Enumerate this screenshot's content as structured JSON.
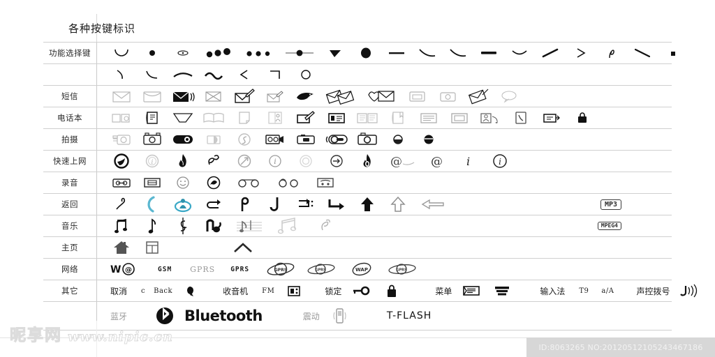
{
  "page": {
    "title": "各种按键标识"
  },
  "rows": [
    {
      "label": "功能选择键",
      "cells": [
        {
          "icon": "arc-down-icon"
        },
        {
          "icon": "dot-icon"
        },
        {
          "icon": "small-oval-icon"
        },
        {
          "icon": "three-dots-bold-icon"
        },
        {
          "icon": "three-dots-icon"
        },
        {
          "icon": "dot-with-line-icon"
        },
        {
          "icon": "triangle-down-icon"
        },
        {
          "icon": "big-dot-icon"
        },
        {
          "icon": "dash-icon"
        },
        {
          "icon": "curve-down-right-icon"
        },
        {
          "icon": "curve-down-right-icon"
        },
        {
          "icon": "dash-bold-icon"
        },
        {
          "icon": "arc-shallow-icon"
        },
        {
          "icon": "slash-up-icon"
        },
        {
          "icon": "chevron-right-icon"
        },
        {
          "icon": "loop-stroke-icon"
        },
        {
          "icon": "slash-down-icon"
        },
        {
          "icon": "square-dot-icon"
        }
      ]
    },
    {
      "label": "",
      "cells": [
        {
          "icon": "hook-stroke-icon"
        },
        {
          "icon": "curve-stroke-icon"
        },
        {
          "icon": "swoosh-icon"
        },
        {
          "icon": "tilde-icon"
        },
        {
          "icon": "chevron-left-icon"
        },
        {
          "icon": "corner-bracket-icon"
        },
        {
          "icon": "circle-outline-icon"
        }
      ]
    },
    {
      "label": "短信",
      "cells": [
        {
          "icon": "envelope-outline-icon"
        },
        {
          "icon": "envelope-flap-icon"
        },
        {
          "icon": "envelope-sound-icon"
        },
        {
          "icon": "envelope-cross-icon"
        },
        {
          "icon": "envelope-pen-icon"
        },
        {
          "icon": "envelope-small-pen-icon"
        },
        {
          "icon": "envelope-bird-icon"
        },
        {
          "icon": "envelope-pair-icon"
        },
        {
          "icon": "envelope-heart-icon"
        },
        {
          "icon": "envelope-box-icon"
        },
        {
          "icon": "envelope-camera-icon"
        },
        {
          "icon": "envelope-arrow-icon"
        },
        {
          "icon": "speech-bubble-icon"
        }
      ]
    },
    {
      "label": "电话本",
      "cells": [
        {
          "icon": "book-search-icon"
        },
        {
          "icon": "contact-card-icon"
        },
        {
          "icon": "open-fold-icon"
        },
        {
          "icon": "open-book-icon"
        },
        {
          "icon": "page-icon"
        },
        {
          "icon": "book-person-icon"
        },
        {
          "icon": "card-pen-icon"
        },
        {
          "icon": "id-card-icon"
        },
        {
          "icon": "open-book-lines-icon"
        },
        {
          "icon": "book-tab-icon"
        },
        {
          "icon": "list-lines-icon"
        },
        {
          "icon": "card-box-icon"
        },
        {
          "icon": "contacts-people-icon"
        },
        {
          "icon": "phone-card-icon"
        },
        {
          "icon": "card-arrow-icon"
        },
        {
          "icon": "lock-book-icon"
        }
      ]
    },
    {
      "label": "拍摄",
      "cells": [
        {
          "icon": "camera-outline-icon"
        },
        {
          "icon": "camera-body-icon"
        },
        {
          "icon": "camera-solid-icon"
        },
        {
          "icon": "camera-flash-icon"
        },
        {
          "icon": "shutter-circle-icon"
        },
        {
          "icon": "video-camera-icon"
        },
        {
          "icon": "compact-camera-icon"
        },
        {
          "icon": "camera-lens-ring-icon"
        },
        {
          "icon": "photo-camera-icon"
        },
        {
          "icon": "lens-small-icon"
        },
        {
          "icon": "lens-solid-icon"
        }
      ]
    },
    {
      "label": "快速上网",
      "cells": [
        {
          "icon": "e-circle-solid-icon"
        },
        {
          "icon": "i-circle-gray-icon"
        },
        {
          "icon": "flame-icon"
        },
        {
          "icon": "e-script-icon"
        },
        {
          "icon": "target-arrow-icon"
        },
        {
          "icon": "i-circle-icon"
        },
        {
          "icon": "circle-ring-icon"
        },
        {
          "icon": "arrow-circle-icon"
        },
        {
          "icon": "flame-bold-icon"
        },
        {
          "icon": "at-tail-icon"
        },
        {
          "icon": "at-icon"
        },
        {
          "icon": "i-italic-icon"
        },
        {
          "icon": "info-circle-icon"
        }
      ]
    },
    {
      "label": "录音",
      "cells": [
        {
          "icon": "cassette-icon"
        },
        {
          "icon": "tape-icon"
        },
        {
          "icon": "smiley-icon"
        },
        {
          "icon": "record-circle-icon"
        },
        {
          "icon": "reel-pair-icon"
        },
        {
          "icon": "reel-small-icon"
        },
        {
          "icon": "tape-box-icon"
        }
      ]
    },
    {
      "label": "返回",
      "badge": "MP3",
      "cells": [
        {
          "icon": "swirl-arrow-icon"
        },
        {
          "icon": "crescent-arrow-icon"
        },
        {
          "icon": "target-person-icon"
        },
        {
          "icon": "return-arrow-icon"
        },
        {
          "icon": "hook-arrow-icon"
        },
        {
          "icon": "down-hook-icon"
        },
        {
          "icon": "tab-arrow-icon"
        },
        {
          "icon": "enter-arrow-icon"
        },
        {
          "icon": "up-arrow-solid-icon"
        },
        {
          "icon": "up-arrow-outline-icon"
        },
        {
          "icon": "left-arrow-outline-icon"
        }
      ]
    },
    {
      "label": "音乐",
      "badge": "MPEG4",
      "badge_sub": "4",
      "cells": [
        {
          "icon": "beamed-notes-icon"
        },
        {
          "icon": "eighth-note-icon"
        },
        {
          "icon": "clef-icon"
        },
        {
          "icon": "note-bold-icon"
        },
        {
          "icon": "staff-notes-icon"
        },
        {
          "icon": "double-note-gray-icon"
        },
        {
          "icon": "note-sketch-icon"
        }
      ]
    },
    {
      "label": "主页",
      "cells": [
        {
          "icon": "home-solid-icon"
        },
        {
          "icon": "window-grid-icon"
        },
        {
          "icon": "roof-icon"
        }
      ]
    },
    {
      "label": "网络",
      "cells": [
        {
          "text": "W@P",
          "style": "wap"
        },
        {
          "text": "GSM",
          "style": "mono"
        },
        {
          "text": "GPRS",
          "style": "serif-gray"
        },
        {
          "text": "GPRS",
          "style": "mono"
        },
        {
          "icon": "orbit-gprs-icon"
        },
        {
          "icon": "orbit-gprs-small-icon"
        },
        {
          "icon": "orbit-wap-icon"
        },
        {
          "icon": "orbit-gprs-alt-icon"
        }
      ]
    },
    {
      "label": "其它",
      "cells": [
        {
          "text": "取消"
        },
        {
          "text": "c",
          "style": "sm"
        },
        {
          "text": "Back",
          "style": "sm"
        },
        {
          "icon": "back-hand-icon"
        },
        {
          "text": "收音机"
        },
        {
          "text": "FM",
          "style": "sm"
        },
        {
          "icon": "radio-icon"
        },
        {
          "text": "锁定"
        },
        {
          "icon": "key-icon"
        },
        {
          "icon": "padlock-icon"
        },
        {
          "text": "菜单"
        },
        {
          "icon": "menu-card-icon"
        },
        {
          "icon": "menu-bars-icon"
        },
        {
          "text": "输入法"
        },
        {
          "text": "T9",
          "style": "sm"
        },
        {
          "text": "a/A",
          "style": "sm"
        },
        {
          "text": "声控拨号"
        },
        {
          "icon": "voice-dial-icon"
        }
      ]
    },
    {
      "label": "",
      "cells": [
        {
          "text": "蓝牙",
          "style": "gray"
        },
        {
          "icon": "bluetooth-logo-icon"
        },
        {
          "text": "Bluetooth",
          "style": "bt"
        },
        {
          "text": "震动",
          "style": "gray"
        },
        {
          "icon": "vibrate-phone-icon"
        },
        {
          "text": "T-FLASH",
          "style": "tflash"
        }
      ]
    }
  ],
  "footer": {
    "watermark_cn": "昵享网",
    "watermark_url": "www.nipic.cn",
    "id_text": "ID:8063265 NO:20120512105243467186"
  }
}
